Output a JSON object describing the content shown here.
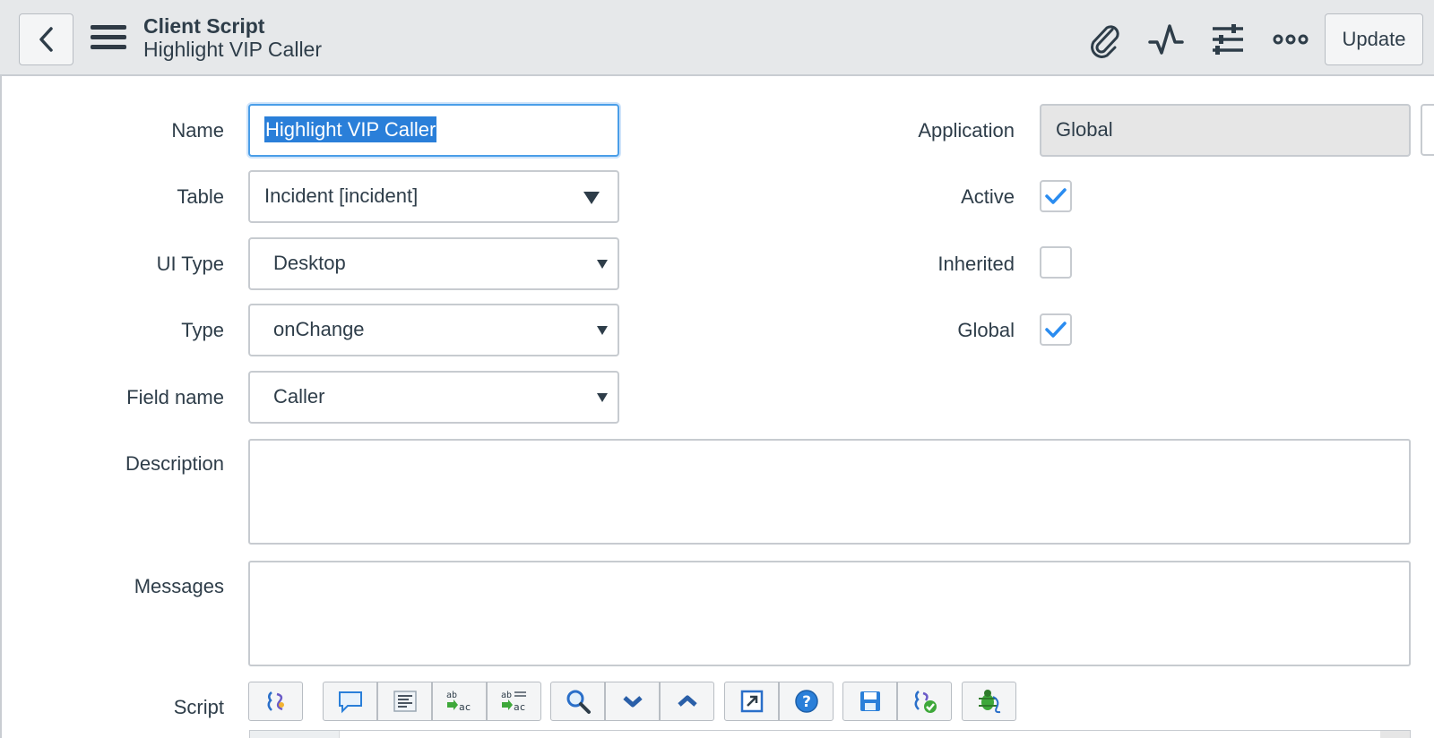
{
  "header": {
    "title": "Client Script",
    "subtitle": "Highlight VIP Caller",
    "update_label": "Update",
    "icons": [
      "back-icon",
      "menu-icon",
      "paperclip-icon",
      "activity-icon",
      "settings-sliders-icon",
      "more-icon"
    ]
  },
  "form": {
    "name": {
      "label": "Name",
      "value": "Highlight VIP Caller"
    },
    "table": {
      "label": "Table",
      "value": "Incident [incident]"
    },
    "ui_type": {
      "label": "UI Type",
      "value": "Desktop"
    },
    "type": {
      "label": "Type",
      "value": "onChange"
    },
    "field_name": {
      "label": "Field name",
      "value": "Caller"
    },
    "description": {
      "label": "Description",
      "value": ""
    },
    "messages": {
      "label": "Messages",
      "value": ""
    },
    "script": {
      "label": "Script"
    },
    "application": {
      "label": "Application",
      "value": "Global"
    },
    "active": {
      "label": "Active",
      "checked": true
    },
    "inherited": {
      "label": "Inherited",
      "checked": false
    },
    "global": {
      "label": "Global",
      "checked": true
    }
  },
  "script_toolbar": {
    "buttons": [
      "format-code-icon",
      "comment-icon",
      "align-text-icon",
      "replace-icon",
      "replace-all-icon",
      "search-icon",
      "next-icon",
      "previous-icon",
      "fullscreen-icon",
      "help-icon",
      "save-icon",
      "validate-script-icon",
      "debug-icon"
    ]
  },
  "colors": {
    "header_bg": "#e6e8ea",
    "accent_blue": "#2a7fd9",
    "checkmark": "#2a8cf0",
    "border": "#c7cbd0"
  }
}
